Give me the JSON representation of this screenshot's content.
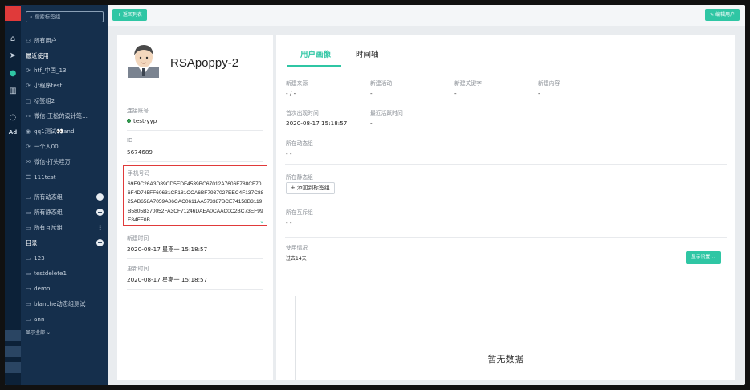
{
  "sidebar": {
    "search_placeholder": "搜索标签组",
    "items": [
      {
        "icon": "users-icon",
        "label": "所有用户"
      },
      {
        "label": "最近使用",
        "head": true
      },
      {
        "icon": "loop-icon",
        "label": "htf_中国_13"
      },
      {
        "icon": "loop-icon",
        "label": "小程序test"
      },
      {
        "icon": "tag-icon",
        "label": "标签组2"
      },
      {
        "icon": "group-icon",
        "label": "微信-王松的设计笔..."
      },
      {
        "icon": "qq-icon",
        "label": "qq1测试👀and"
      },
      {
        "icon": "loop-icon",
        "label": "一个人00"
      },
      {
        "icon": "group-icon",
        "label": "微信-打头哇万"
      },
      {
        "icon": "list-icon",
        "label": "111test"
      }
    ],
    "groups": [
      {
        "label": "所有动态组",
        "action": "+"
      },
      {
        "label": "所有静态组",
        "action": "+"
      },
      {
        "label": "所有互斥组",
        "action": "⋮"
      }
    ],
    "dir_title": "目录",
    "folders": [
      "123",
      "testdelete1",
      "demo",
      "blanche动态组测试",
      "ann"
    ],
    "show_all": "显示全部 ⌄"
  },
  "topbar": {
    "back_label": "+ 返回列表",
    "edit_label": "✎ 编辑用户"
  },
  "profile": {
    "name": "RSApoppy-2",
    "connected_label": "连接账号",
    "connected_value": "test-yyp",
    "id_label": "ID",
    "id_value": "5674689",
    "phone_label": "手机号码",
    "phone_value": "69E9C26A3D89CD5EDF4539BC67012A7606F788CF706F4D745FF60631CF181CCA6BF7937027EEC4F137C8825AB658A7059A06CAC0611AA573387BCE74158B3119B5805B370052FA3CF71246DAEA0CAAC0C2BC73EF99E84FF0B...",
    "phone_more": "⌄",
    "created_label": "新建时间",
    "created_value": "2020-08-17 星期一 15:18:57",
    "updated_label": "更新时间",
    "updated_value": "2020-08-17 星期一 15:18:57"
  },
  "tabs": [
    "用户画像",
    "时间轴"
  ],
  "portrait": {
    "fields_row1": [
      {
        "label": "新建来源",
        "value": "- / -"
      },
      {
        "label": "新建活动",
        "value": "-"
      },
      {
        "label": "新建关键字",
        "value": "-"
      },
      {
        "label": "新建内容",
        "value": "-"
      }
    ],
    "fields_row2": [
      {
        "label": "首次出现时间",
        "value": "2020-08-17 15:18:57"
      },
      {
        "label": "最近活跃时间",
        "value": "-"
      }
    ],
    "dynamic_label": "所在动态组",
    "dynamic_value": "- -",
    "static_label": "所在静态组",
    "add_tag_label": "+ 添加到标签组",
    "mutex_label": "所在互斥组",
    "mutex_value": "- -",
    "usage_label": "使用情况",
    "usage_period": "过去14天",
    "stats_btn": "显示设置 ⌄",
    "empty": "暂无数据"
  }
}
